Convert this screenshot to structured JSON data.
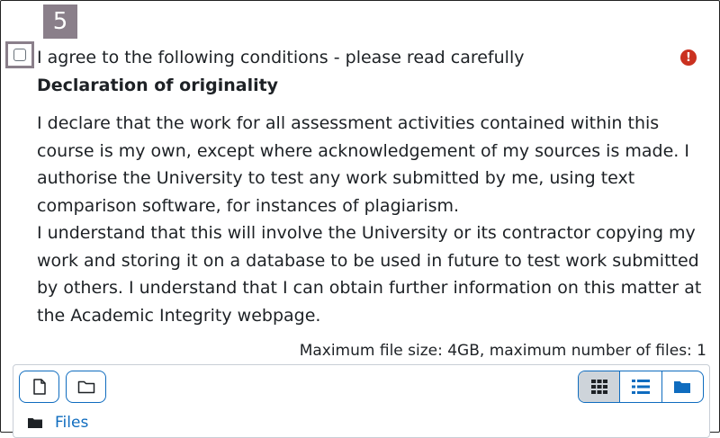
{
  "step": {
    "number": "5"
  },
  "agreement": {
    "checkbox_label": "I agree to the following conditions - please read carefully",
    "required_icon": "exclamation-circle-icon",
    "title": "Declaration of originality",
    "paragraphs": [
      "I declare that the work for all assessment activities contained within this",
      "course is my own, except where acknowledgement of my sources is made. I",
      "authorise the University to test any work submitted by me, using text",
      "comparison software, for instances of plagiarism.",
      "I understand that this will involve the University or its contractor copying my",
      "work and storing it on a database to be used in future to test work submitted",
      "by others. I understand that I can obtain further information on this matter at",
      "the Academic Integrity webpage."
    ]
  },
  "filemanager": {
    "limits": "Maximum file size: 4GB, maximum number of files: 1",
    "breadcrumb": "Files",
    "icons": {
      "add_file": "file-icon",
      "create_folder": "folder-icon",
      "view_icons": "grid-icon",
      "view_list": "list-icon",
      "view_tree": "folder-solid-icon"
    },
    "colors": {
      "accent": "#0f6cbf",
      "active_view_bg": "#ced4da",
      "required": "#ca3120"
    }
  }
}
